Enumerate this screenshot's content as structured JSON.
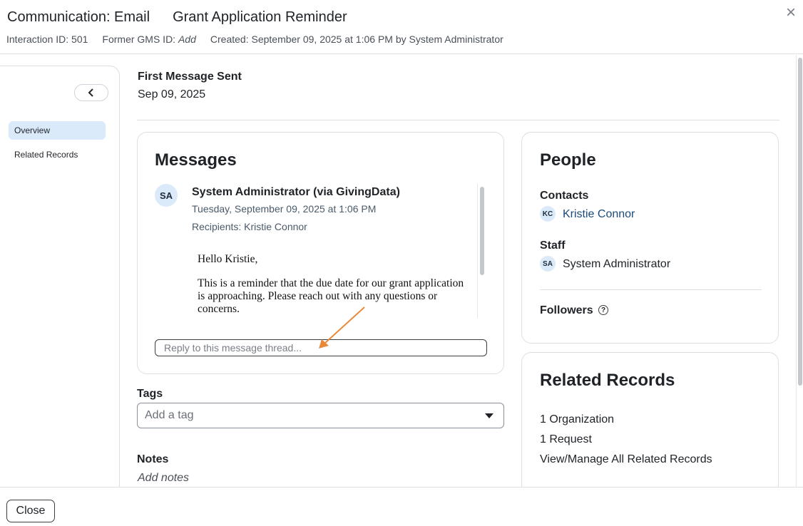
{
  "header": {
    "title": "Communication: Email",
    "subject": "Grant Application Reminder",
    "interaction_id": "Interaction ID: 501",
    "former_gms_label": "Former GMS ID: ",
    "former_gms_value": "Add",
    "created": "Created: September 09, 2025 at 1:06 PM by System Administrator",
    "close_icon": "×"
  },
  "sidebar": {
    "collapse_icon": "chevron-left-icon",
    "items": [
      {
        "label": "Overview",
        "active": true
      },
      {
        "label": "Related Records",
        "active": false
      }
    ]
  },
  "summary": {
    "first_message_label": "First Message Sent",
    "first_message_date": "Sep 09, 2025"
  },
  "messages": {
    "title": "Messages",
    "sender_initials": "SA",
    "sender": "System Administrator (via GivingData)",
    "date": "Tuesday, September 09, 2025 at 1:06 PM",
    "recipients": "Recipients: Kristie Connor",
    "body": [
      "Hello Kristie,",
      "This is a reminder that the due date for our grant application is approaching. Please reach out with any questions or concerns."
    ],
    "reply_placeholder": "Reply to this message thread..."
  },
  "tags": {
    "label": "Tags",
    "placeholder": "Add a tag"
  },
  "notes": {
    "label": "Notes",
    "placeholder": "Add notes"
  },
  "people": {
    "title": "People",
    "contacts_label": "Contacts",
    "contact_initials": "KC",
    "contact_name": "Kristie Connor",
    "staff_label": "Staff",
    "staff_initials": "SA",
    "staff_name": "System Administrator",
    "followers_label": "Followers",
    "help_icon": "?"
  },
  "related": {
    "title": "Related Records",
    "organization": "1 Organization",
    "request": "1 Request",
    "view_all": "View/Manage All Related Records"
  },
  "footer": {
    "close_label": "Close"
  },
  "colors": {
    "accent_link": "#1a4a7a",
    "active_nav": "#dbeafb",
    "annotation_arrow": "#e8893a"
  }
}
